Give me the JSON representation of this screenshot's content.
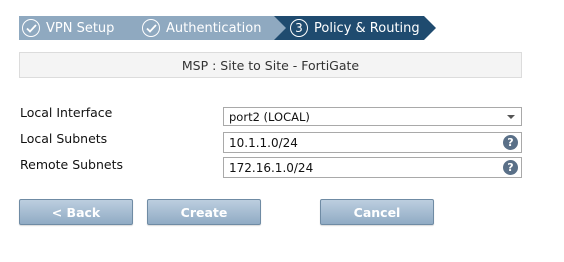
{
  "wizard": {
    "steps": [
      {
        "label": "VPN Setup",
        "state": "done",
        "icon": "check-icon"
      },
      {
        "label": "Authentication",
        "state": "done",
        "icon": "check-icon"
      },
      {
        "label": "Policy & Routing",
        "state": "active",
        "number": "3"
      }
    ]
  },
  "title": "MSP : Site to Site - FortiGate",
  "form": {
    "local_interface": {
      "label": "Local Interface",
      "value": "port2 (LOCAL)"
    },
    "local_subnets": {
      "label": "Local Subnets",
      "value": "10.1.1.0/24",
      "help": "?"
    },
    "remote_subnets": {
      "label": "Remote Subnets",
      "value": "172.16.1.0/24",
      "help": "?"
    }
  },
  "buttons": {
    "back": "< Back",
    "create": "Create",
    "cancel": "Cancel"
  },
  "colors": {
    "step_done": "#8fa9c0",
    "step_active": "#1f4b6f",
    "button_gradient_top": "#bccedf",
    "button_gradient_bottom": "#90abc4"
  }
}
